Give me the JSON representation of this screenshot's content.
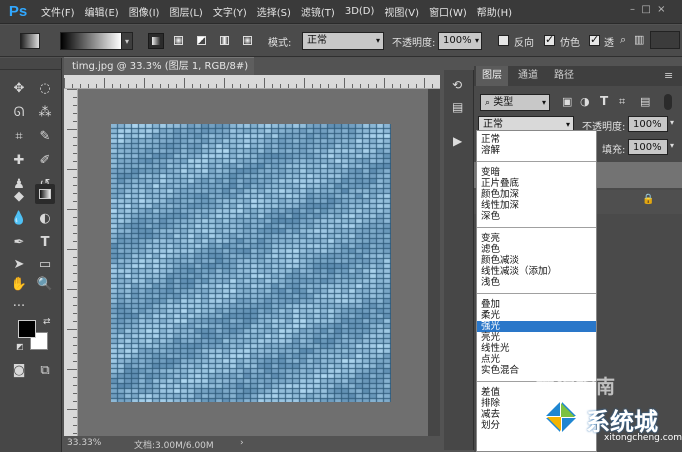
{
  "app": {
    "logo": "Ps"
  },
  "menu": [
    "文件(F)",
    "编辑(E)",
    "图像(I)",
    "图层(L)",
    "文字(Y)",
    "选择(S)",
    "滤镜(T)",
    "3D(D)",
    "视图(V)",
    "窗口(W)",
    "帮助(H)"
  ],
  "options": {
    "mode_label": "模式:",
    "mode_value": "正常",
    "opacity_label": "不透明度:",
    "opacity_value": "100%",
    "reverse_label": "反向",
    "dither_label": "仿色",
    "transparency_label": "透"
  },
  "document": {
    "tab_title": "timg.jpg @ 33.3% (图层 1, RGB/8#) *",
    "zoom": "33.33%",
    "doc_info": "文档:3.00M/6.00M"
  },
  "panel": {
    "tabs": [
      "图层",
      "通道",
      "路径"
    ],
    "filter_label": "类型",
    "blend_value": "正常",
    "opacity_label": "不透明度:",
    "opacity_value": "100%",
    "fill_label": "填充:",
    "fill_value": "100%"
  },
  "blend_modes": {
    "group1": [
      "正常",
      "溶解"
    ],
    "group2": [
      "变暗",
      "正片叠底",
      "颜色加深",
      "线性加深",
      "深色"
    ],
    "group3": [
      "变亮",
      "滤色",
      "颜色减淡",
      "线性减淡（添加）",
      "浅色"
    ],
    "group4": [
      "叠加",
      "柔光",
      "强光",
      "亮光",
      "线性光",
      "点光",
      "实色混合"
    ],
    "group5": [
      "差值",
      "排除",
      "减去",
      "划分"
    ],
    "selected": "强光"
  },
  "watermark": {
    "sogou": "搜狗指南",
    "brand": "系统城",
    "url": "xitongcheng.com"
  }
}
